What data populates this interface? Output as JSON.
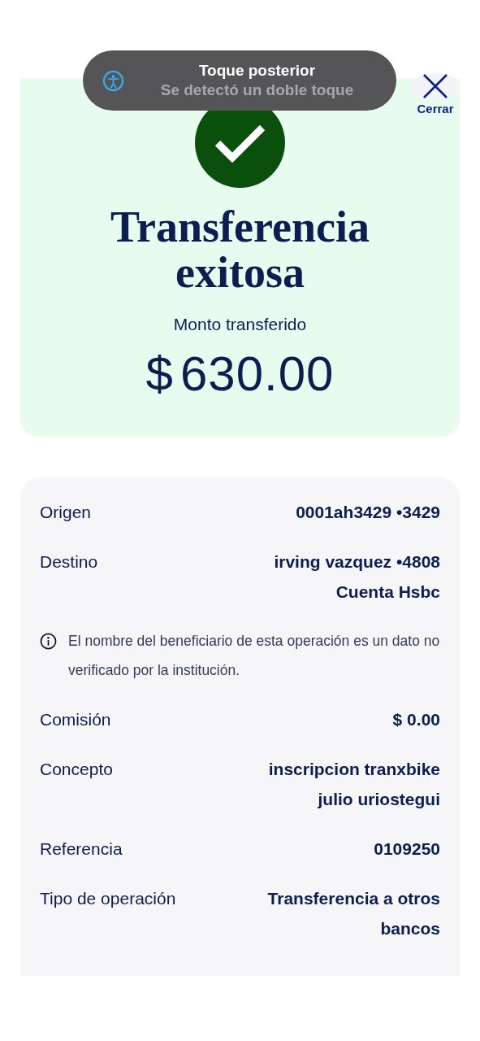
{
  "toast": {
    "title": "Toque posterior",
    "subtitle": "Se detectó un doble toque"
  },
  "close_button": {
    "label": "Cerrar"
  },
  "result": {
    "title": "Transferencia exitosa",
    "amount_label": "Monto transferido",
    "currency": "$",
    "amount": "630.00"
  },
  "details": [
    {
      "kind": "row",
      "label": "Origen",
      "value": "0001ah3429 •3429"
    },
    {
      "kind": "row",
      "label": "Destino",
      "value": "irving vazquez •4808",
      "detail": "Cuenta Hsbc"
    },
    {
      "kind": "note",
      "text": "El nombre del beneficiario de esta operación es un dato no verificado por la institución."
    },
    {
      "kind": "row",
      "label": "Comisión",
      "value": "$ 0.00"
    },
    {
      "kind": "row",
      "label": "Concepto",
      "value": "inscripcion tranxbike julio uriostegui"
    },
    {
      "kind": "row",
      "label": "Referencia",
      "value": "0109250"
    },
    {
      "kind": "row",
      "label": "Tipo de operación",
      "value": "Transferencia a otros bancos"
    }
  ]
}
